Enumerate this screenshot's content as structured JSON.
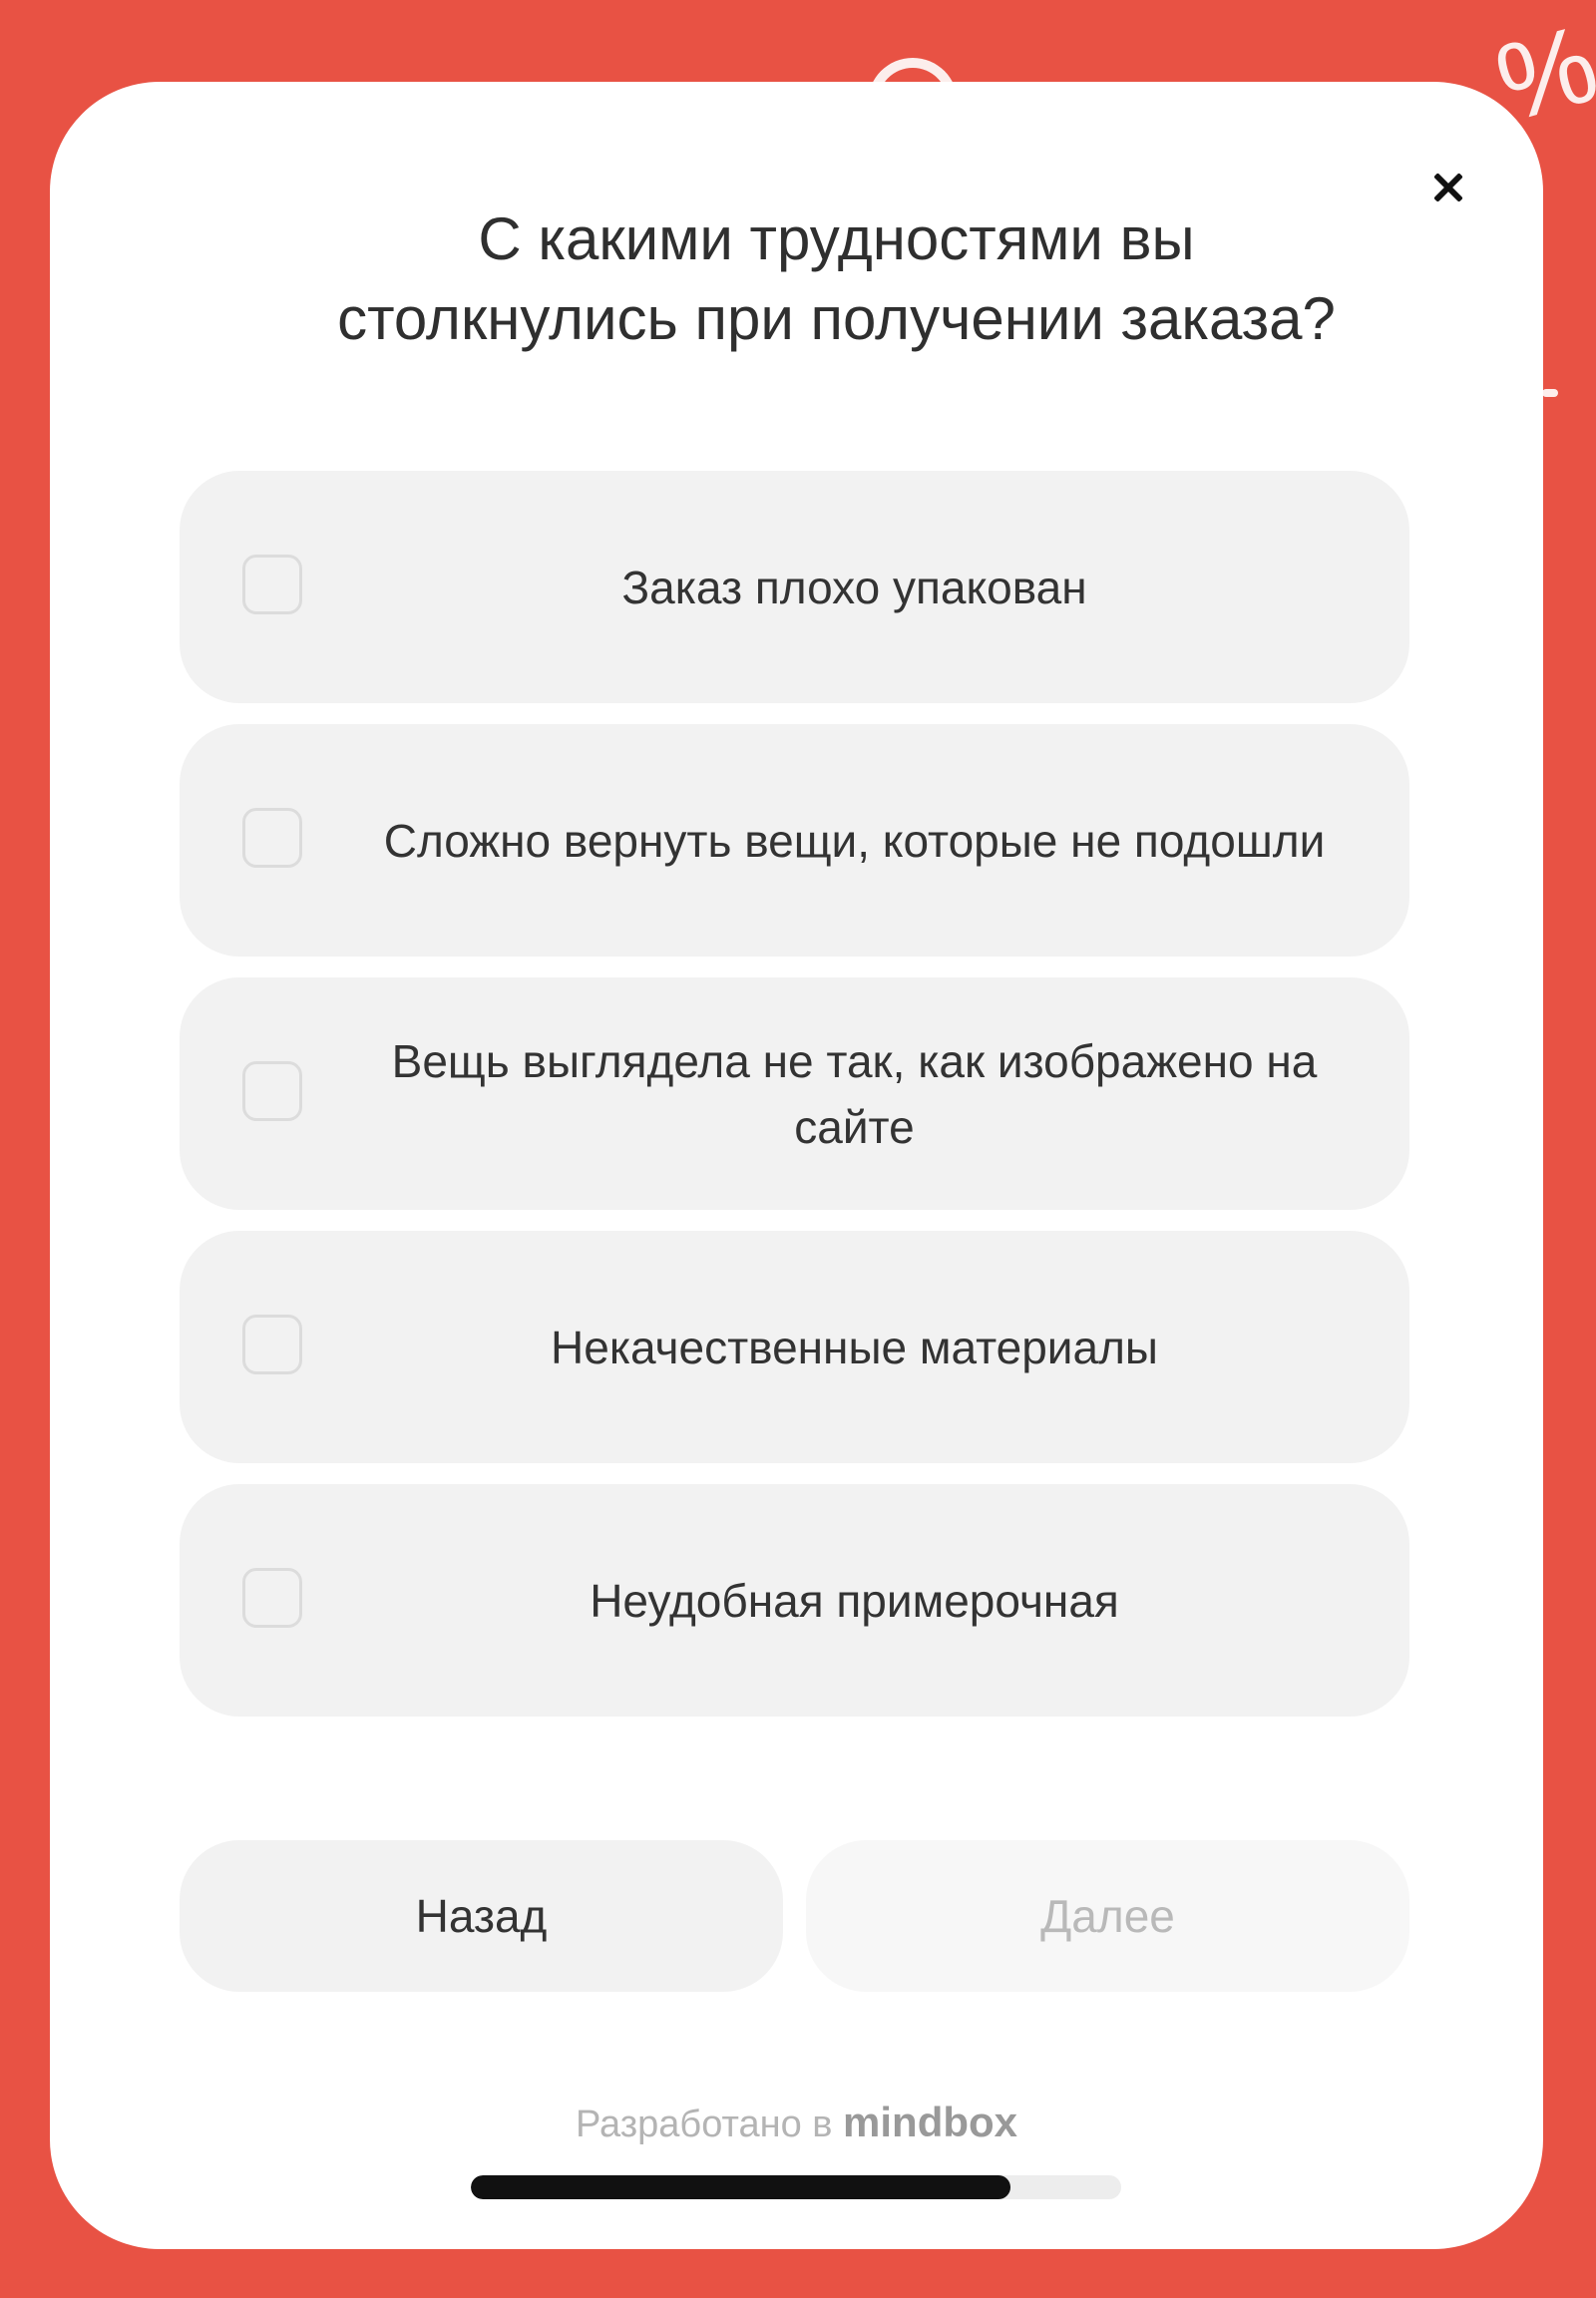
{
  "survey": {
    "title": "С какими трудностями вы\nстолкнулись при получении заказа?",
    "options": [
      {
        "label": "Заказ плохо упакован",
        "checked": false
      },
      {
        "label": "Сложно вернуть вещи, которые не подошли",
        "checked": false
      },
      {
        "label": "Вещь выглядела не так, как изображено на сайте",
        "checked": false
      },
      {
        "label": "Некачественные материалы",
        "checked": false
      },
      {
        "label": "Неудобная примерочная",
        "checked": false
      }
    ],
    "back_label": "Назад",
    "next_label": "Далее",
    "next_enabled": false,
    "powered_by_prefix": "Разработано в",
    "powered_by_brand": "mindbox",
    "progress_fraction": 0.83
  },
  "background": {
    "decoration": "%"
  },
  "colors": {
    "background": "#e85244",
    "modal": "#ffffff",
    "option_bg": "#f2f2f2",
    "progress_fill": "#111111",
    "progress_track": "#ededed"
  }
}
